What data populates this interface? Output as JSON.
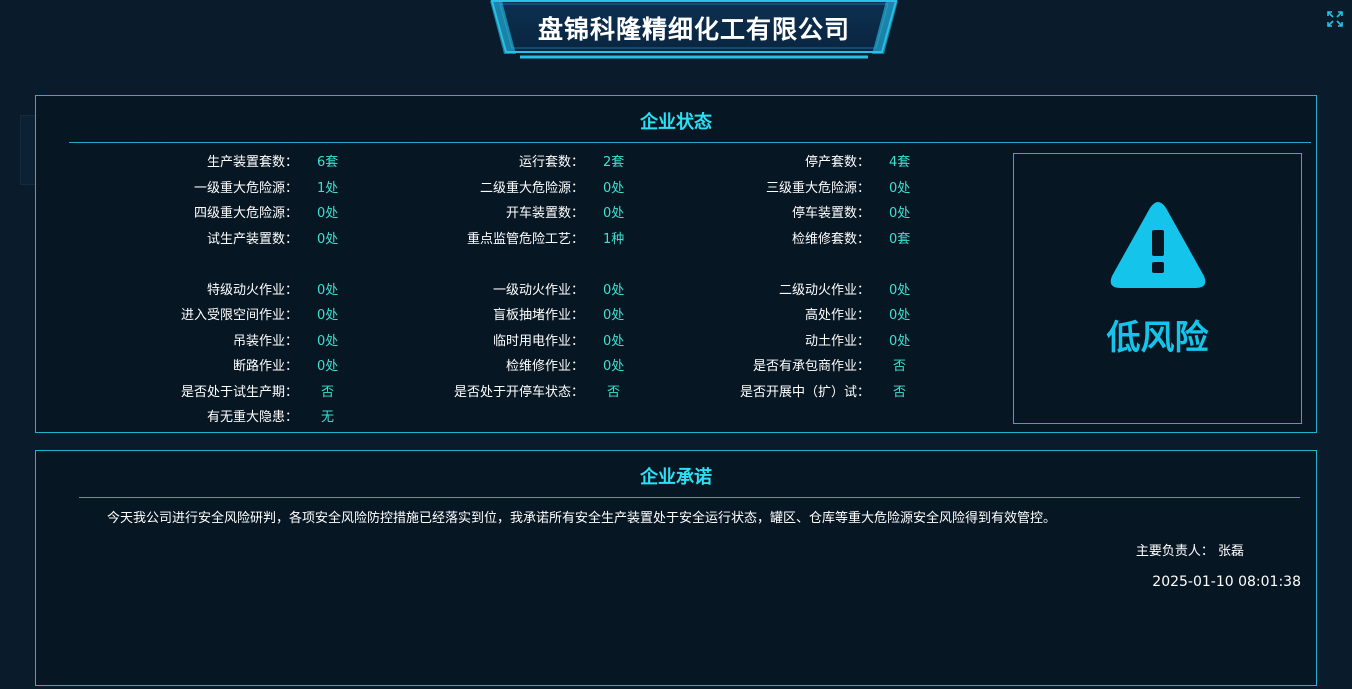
{
  "company_name": "盘锦科隆精细化工有限公司",
  "icons": {
    "fullscreen": "expand-icon",
    "risk": "warning-triangle-icon"
  },
  "colors": {
    "accent": "#2ae0f5",
    "value": "#3ce0cf",
    "risk": "#15c4ea",
    "border": "#1fb3cf",
    "background": "#0a1c2c"
  },
  "status_panel": {
    "title": "企业状态",
    "rows": [
      [
        {
          "label": "生产装置套数：",
          "value": "6套"
        },
        {
          "label": "运行套数：",
          "value": "2套"
        },
        {
          "label": "停产套数：",
          "value": "4套"
        }
      ],
      [
        {
          "label": "一级重大危险源：",
          "value": "1处"
        },
        {
          "label": "二级重大危险源：",
          "value": "0处"
        },
        {
          "label": "三级重大危险源：",
          "value": "0处"
        }
      ],
      [
        {
          "label": "四级重大危险源：",
          "value": "0处"
        },
        {
          "label": "开车装置数：",
          "value": "0处"
        },
        {
          "label": "停车装置数：",
          "value": "0处"
        }
      ],
      [
        {
          "label": "试生产装置数：",
          "value": "0处"
        },
        {
          "label": "重点监管危险工艺：",
          "value": "1种"
        },
        {
          "label": "检维修套数：",
          "value": "0套"
        }
      ],
      [
        {
          "label": "特级动火作业：",
          "value": "0处"
        },
        {
          "label": "一级动火作业：",
          "value": "0处"
        },
        {
          "label": "二级动火作业：",
          "value": "0处"
        }
      ],
      [
        {
          "label": "进入受限空间作业：",
          "value": "0处"
        },
        {
          "label": "盲板抽堵作业：",
          "value": "0处"
        },
        {
          "label": "高处作业：",
          "value": "0处"
        }
      ],
      [
        {
          "label": "吊装作业：",
          "value": "0处"
        },
        {
          "label": "临时用电作业：",
          "value": "0处"
        },
        {
          "label": "动土作业：",
          "value": "0处"
        }
      ],
      [
        {
          "label": "断路作业：",
          "value": "0处"
        },
        {
          "label": "检维修作业：",
          "value": "0处"
        },
        {
          "label": "是否有承包商作业：",
          "value": "否"
        }
      ],
      [
        {
          "label": "是否处于试生产期：",
          "value": "否"
        },
        {
          "label": "是否处于开停车状态：",
          "value": "否"
        },
        {
          "label": "是否开展中（扩）试：",
          "value": "否"
        }
      ],
      [
        {
          "label": "有无重大隐患：",
          "value": "无"
        }
      ]
    ],
    "risk_level": "低风险"
  },
  "promise_panel": {
    "title": "企业承诺",
    "text": "今天我公司进行安全风险研判，各项安全风险防控措施已经落实到位，我承诺所有安全生产装置处于安全运行状态，罐区、仓库等重大危险源安全风险得到有效管控。",
    "person_label": "主要负责人：",
    "person_name": "张磊",
    "timestamp": "2025-01-10 08:01:38"
  }
}
